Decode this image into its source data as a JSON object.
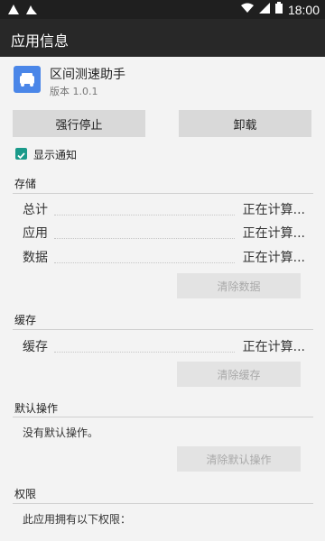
{
  "status_bar": {
    "time": "18:00"
  },
  "app_bar": {
    "title": "应用信息"
  },
  "app": {
    "name": "区间测速助手",
    "version": "版本 1.0.1"
  },
  "buttons": {
    "force_stop": "强行停止",
    "uninstall": "卸载"
  },
  "notification": {
    "label": "显示通知",
    "checked": true
  },
  "storage": {
    "title": "存储",
    "rows": [
      {
        "label": "总计",
        "value": "正在计算..."
      },
      {
        "label": "应用",
        "value": "正在计算..."
      },
      {
        "label": "数据",
        "value": "正在计算..."
      }
    ],
    "clear_button": "清除数据"
  },
  "cache": {
    "title": "缓存",
    "rows": [
      {
        "label": "缓存",
        "value": "正在计算..."
      }
    ],
    "clear_button": "清除缓存"
  },
  "default_actions": {
    "title": "默认操作",
    "text": "没有默认操作。",
    "clear_button": "清除默认操作"
  },
  "permissions": {
    "title": "权限",
    "text": "此应用拥有以下权限："
  }
}
